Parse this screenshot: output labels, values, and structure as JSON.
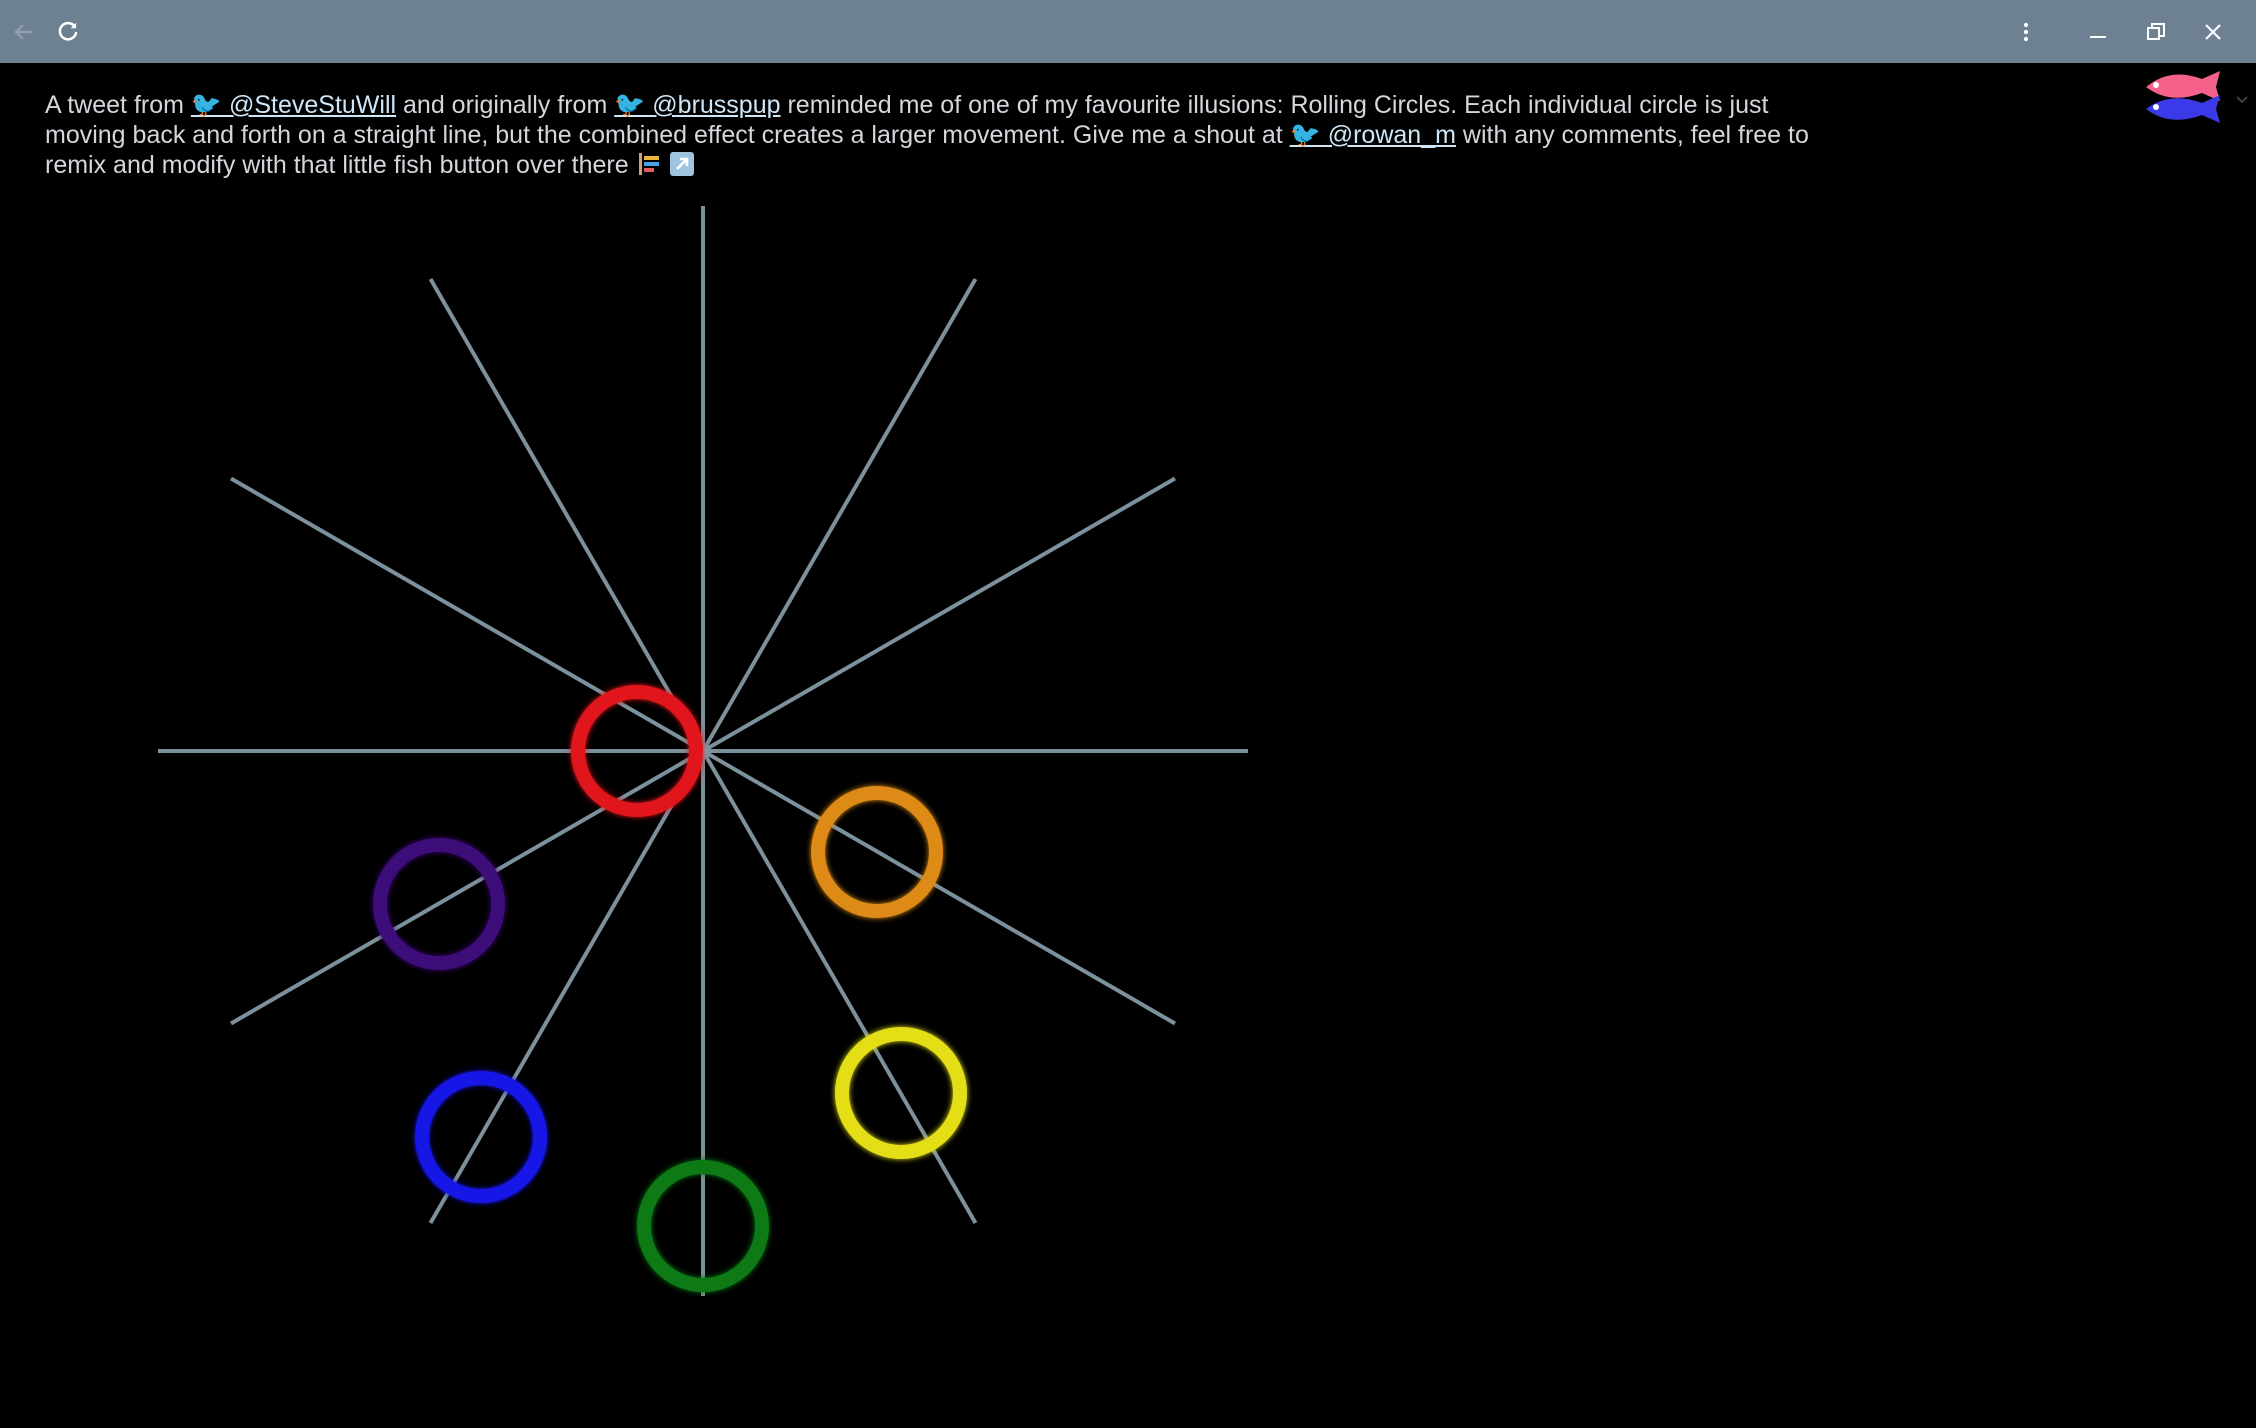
{
  "window": {
    "back_icon": "arrow-left-icon",
    "reload_icon": "reload-icon",
    "menu_icon": "kebab-menu-icon",
    "minimize_icon": "minimize-icon",
    "restore_icon": "restore-icon",
    "close_icon": "close-icon",
    "bar_color": "#6e8193"
  },
  "intro": {
    "t1": "A tweet from ",
    "link1": "🐦 @SteveStuWill",
    "t2": " and originally from ",
    "link2": "🐦 @brusspup",
    "t3": " reminded me of one of my favourite illusions: Rolling Circles. Each individual circle is just moving back and forth on a straight line, but the combined effect creates a larger movement. Give me a shout at ",
    "link3": "🐦 @rowan_m",
    "t4": " with any comments, feel free to remix and modify with that little fish button over there ",
    "emoji1": "palette-emoji",
    "emoji2": "arrow-up-right-emoji"
  },
  "illusion": {
    "line_color": "#8aa1ad",
    "line_count": 12,
    "circles": [
      {
        "name": "red",
        "color": "#e0161a"
      },
      {
        "name": "orange",
        "color": "#dd8a12"
      },
      {
        "name": "yellow",
        "color": "#e3de16"
      },
      {
        "name": "green",
        "color": "#0f7a12"
      },
      {
        "name": "blue",
        "color": "#1414e6"
      },
      {
        "name": "purple",
        "color": "#3d0a7a"
      }
    ]
  },
  "remix_button": {
    "icon": "fish-icon",
    "colors": [
      "#f4618a",
      "#3a3ae8"
    ]
  }
}
